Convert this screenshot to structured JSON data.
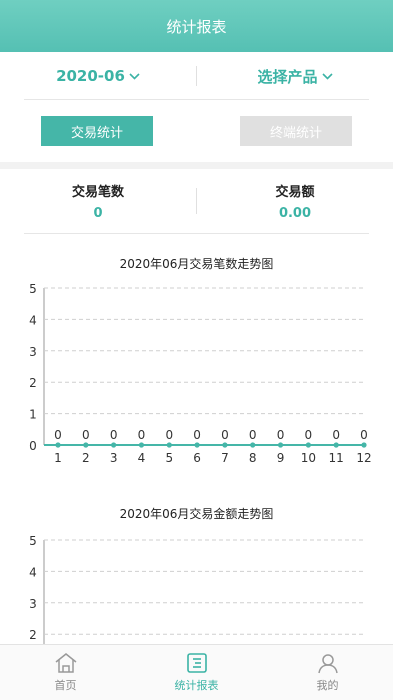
{
  "header": {
    "title": "统计报表"
  },
  "filters": {
    "month": "2020-06",
    "product": "选择产品"
  },
  "tabs": {
    "transaction_stats": "交易统计",
    "terminal_stats": "终端统计"
  },
  "summary": {
    "count_label": "交易笔数",
    "count_value": "0",
    "amount_label": "交易额",
    "amount_value": "0.00"
  },
  "charts": {
    "count_title": "2020年06月交易笔数走势图",
    "amount_title": "2020年06月交易金额走势图"
  },
  "chart_data": [
    {
      "type": "line",
      "title": "2020年06月交易笔数走势图",
      "x": [
        1,
        2,
        3,
        4,
        5,
        6,
        7,
        8,
        9,
        10,
        11,
        12
      ],
      "values": [
        0,
        0,
        0,
        0,
        0,
        0,
        0,
        0,
        0,
        0,
        0,
        0
      ],
      "ylim": [
        0,
        5
      ],
      "yticks": [
        0,
        1,
        2,
        3,
        4,
        5
      ],
      "grid": true,
      "line_color": "#45b6a8"
    },
    {
      "type": "line",
      "title": "2020年06月交易金额走势图",
      "yticks_visible": [
        2,
        3,
        4,
        5
      ],
      "ylim": [
        0,
        5
      ],
      "grid": true
    }
  ],
  "tabbar": {
    "home": "首页",
    "reports": "统计报表",
    "mine": "我的"
  },
  "colors": {
    "accent": "#45b6a8",
    "header": "#5cc5b8",
    "inactive": "#e0e0e0"
  }
}
